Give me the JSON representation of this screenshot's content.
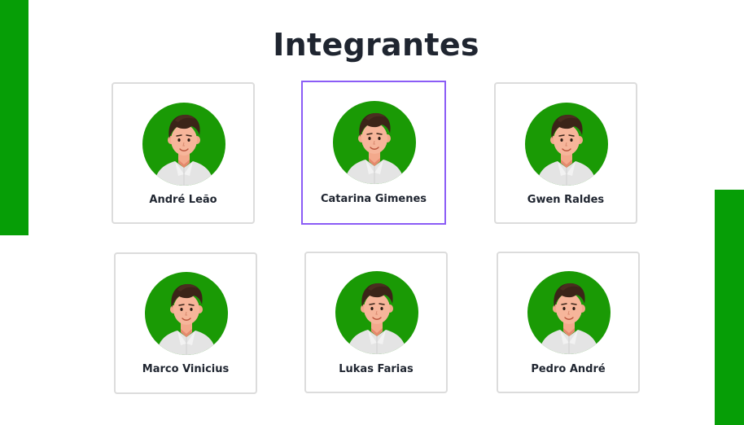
{
  "section": {
    "title": "Integrantes"
  },
  "members": [
    {
      "name": "André Leão"
    },
    {
      "name": "Catarina Gimenes"
    },
    {
      "name": "Gwen Raldes"
    },
    {
      "name": "Marco Vinicius"
    },
    {
      "name": "Lukas Farias"
    },
    {
      "name": "Pedro André"
    }
  ],
  "colors": {
    "accent_green": "#069e06",
    "avatar_green": "#1a9a05",
    "selection_border": "#8b5cf6",
    "title_text": "#1f2530"
  },
  "icons": {
    "avatar": "cartoon-person-avatar-icon"
  }
}
